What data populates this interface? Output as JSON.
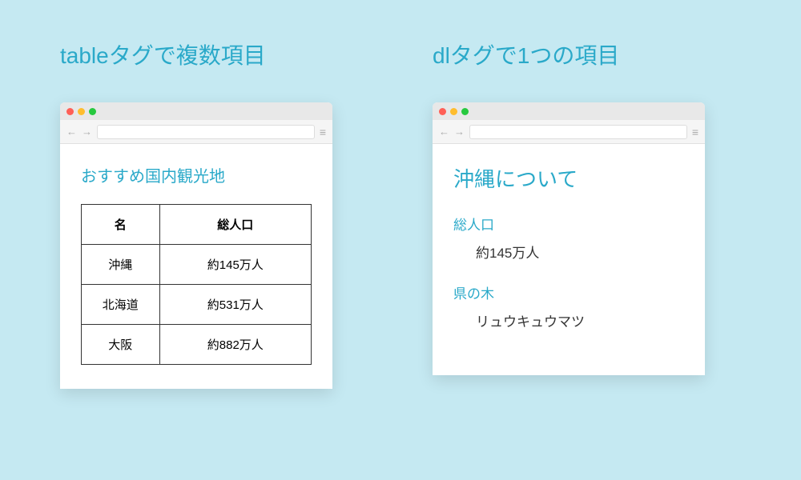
{
  "left": {
    "heading": "tableタグで複数項目",
    "contentTitle": "おすすめ国内観光地",
    "headers": {
      "name": "名",
      "population": "総人口"
    },
    "rows": [
      {
        "name": "沖縄",
        "population": "約145万人"
      },
      {
        "name": "北海道",
        "population": "約531万人"
      },
      {
        "name": "大阪",
        "population": "約882万人"
      }
    ]
  },
  "right": {
    "heading": "dlタグで1つの項目",
    "contentTitle": "沖縄について",
    "items": [
      {
        "term": "総人口",
        "def": "約145万人"
      },
      {
        "term": "県の木",
        "def": "リュウキュウマツ"
      }
    ]
  }
}
